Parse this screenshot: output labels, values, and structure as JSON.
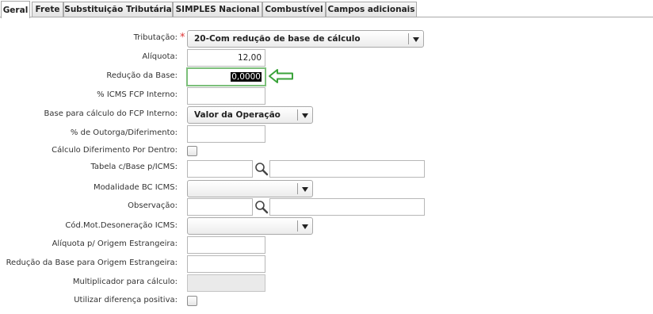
{
  "tabs": [
    {
      "label": "Geral",
      "active": true
    },
    {
      "label": "Frete",
      "active": false
    },
    {
      "label": "Substituição Tributária",
      "active": false
    },
    {
      "label": "SIMPLES Nacional",
      "active": false
    },
    {
      "label": "Combustível",
      "active": false
    },
    {
      "label": "Campos adicionais",
      "active": false
    }
  ],
  "form": {
    "tributacao": {
      "label": "Tributação:",
      "required_mark": "*",
      "value": "20-Com redução de base de cálculo"
    },
    "aliquota": {
      "label": "Alíquota:",
      "value": "12,00"
    },
    "reducao_base": {
      "label": "Redução da Base:",
      "value": "0,0000"
    },
    "icms_fcp": {
      "label": "% ICMS FCP Interno:",
      "value": ""
    },
    "base_fcp": {
      "label": "Base para cálculo do FCP Interno:",
      "value": "Valor da Operação"
    },
    "outorga": {
      "label": "% de Outorga/Diferimento:",
      "value": ""
    },
    "diferimento_dentro": {
      "label": "Cálculo Diferimento Por Dentro:",
      "checked": false
    },
    "tabela_base": {
      "label": "Tabela c/Base p/ICMS:",
      "code": "",
      "description": ""
    },
    "modalidade_bc": {
      "label": "Modalidade BC ICMS:",
      "value": ""
    },
    "observacao": {
      "label": "Observação:",
      "code": "",
      "description": ""
    },
    "cod_desoneracao": {
      "label": "Cód.Mot.Desoneração ICMS:",
      "value": ""
    },
    "aliquota_origem_estrangeira": {
      "label": "Alíquota p/ Origem Estrangeira:",
      "value": ""
    },
    "reducao_origem_estrangeira": {
      "label": "Redução da Base para Origem Estrangeira:",
      "value": ""
    },
    "multiplicador": {
      "label": "Multiplicador para cálculo:",
      "value": ""
    },
    "diferenca_positiva": {
      "label": "Utilizar diferença positiva:",
      "checked": false
    }
  },
  "colors": {
    "arrow": "#3aa33a",
    "focus_border": "#7cbf7a",
    "required": "#d33333"
  }
}
